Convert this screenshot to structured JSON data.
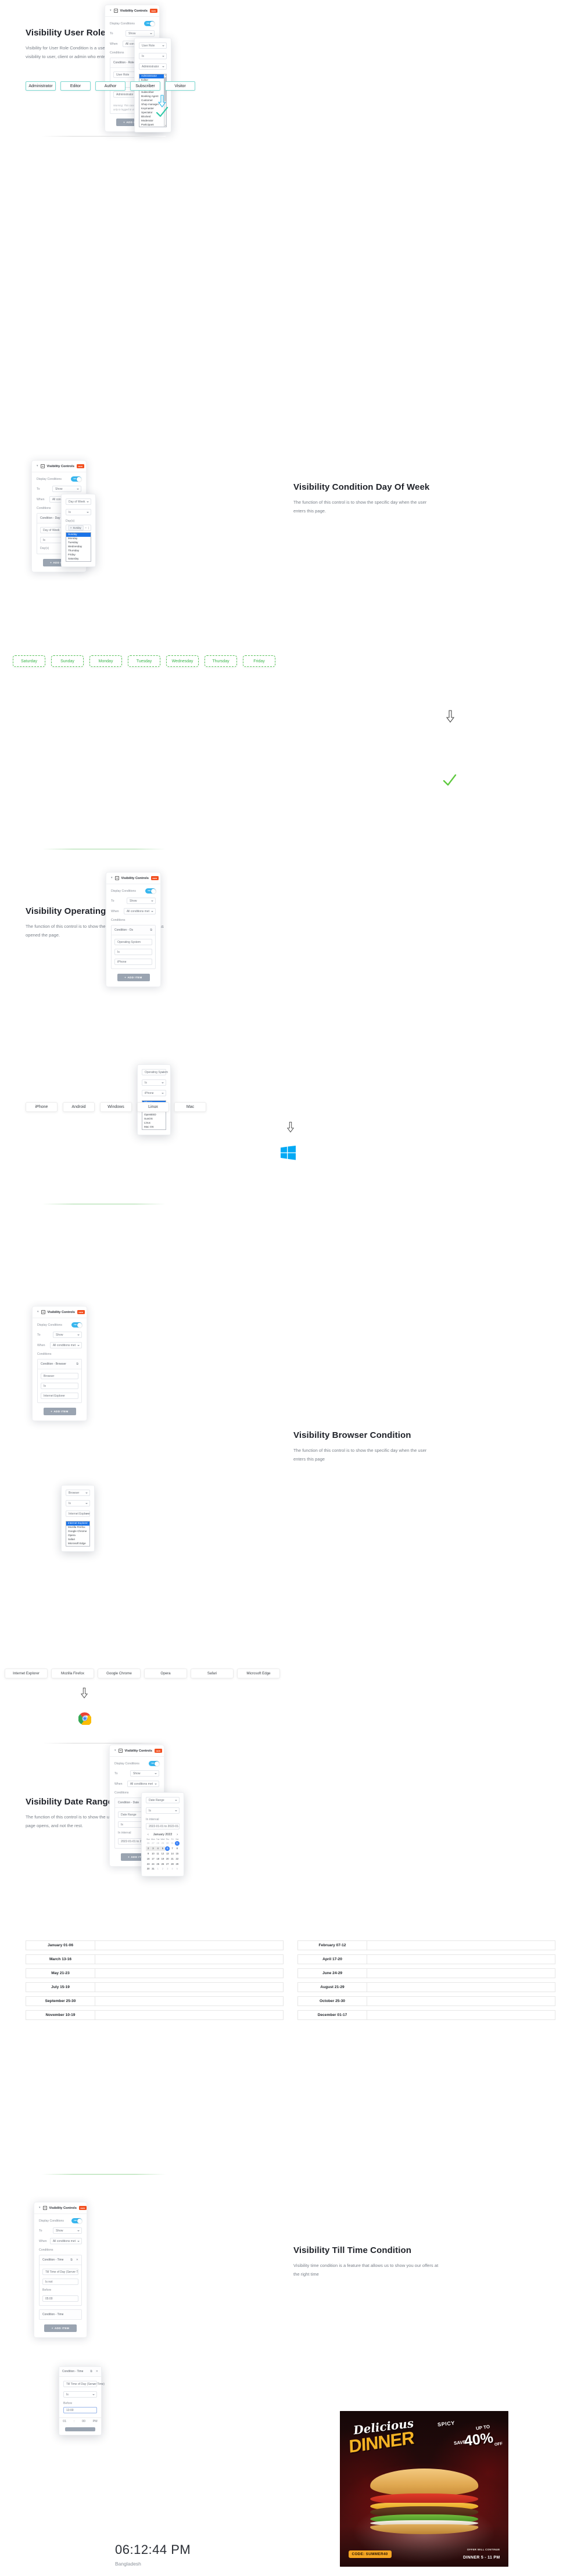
{
  "panel": {
    "title": "Visibility Controls",
    "badge": "NEW",
    "display_conditions_label": "Display Conditions",
    "toggle_state": "YES",
    "to_label": "To",
    "to_value": "Show",
    "when_label": "When",
    "when_value": "All conditions met",
    "conditions_label": "Conditions",
    "add_item_label": "ADD ITEM",
    "add_item_icon": "plus-icon",
    "duplicate_icon": "duplicate-icon",
    "remove_icon": "close-icon",
    "collapse_icon": "chevron-down-icon",
    "page_icon": "page-icon"
  },
  "sections": [
    {
      "id": "user-role",
      "title": "Visibility User Role Condition",
      "body": "Visibility for User Role Condition is a useful add on which provides the visibility to user, client or admin who enters this page.",
      "condition_name": "Condition - Role",
      "field1": "User Role",
      "field2": "Is",
      "field3": "Administrator",
      "warning": "Warning: This condition applies only to logged in visitors.",
      "popup": {
        "select1": "User Role",
        "select2": "Is",
        "select3": "Administrator",
        "options": [
          "Administrator",
          "Editor",
          "Author",
          "Contributor",
          "Subscriber",
          "Booking Agent",
          "Customer",
          "Shop manager",
          "Keymaster",
          "Spectator",
          "Blocked",
          "Moderator",
          "Participant",
          "Shop Accountant",
          "Shop Worker",
          "Shop Vendor",
          "Tutor Instructor",
          "GiveWP Manager",
          "GiveWP Accountant"
        ],
        "selected": "Administrator"
      },
      "pills": [
        "Administrator",
        "Editor",
        "Author",
        "Subscriber",
        "Visitor"
      ],
      "result_icon": "check-icon",
      "arrow_icon": "arrow-down-icon"
    },
    {
      "id": "day-of-week",
      "title": "Visibility Condition Day Of Week",
      "body": "The function of this control is to show the specific day when the user enters this page.",
      "condition_name": "Condition - Day",
      "field1": "Day of Week",
      "field2": "Is",
      "field3_label": "Day(s)",
      "popup": {
        "select1": "Day of Week",
        "select2": "Is",
        "days_label": "Day(s)",
        "chip": "Sunday",
        "chip_remove_icon": "close-icon",
        "chip_add_icon": "plus-icon",
        "options": [
          "Sunday",
          "Monday",
          "Tuesday",
          "Wednesday",
          "Thursday",
          "Friday",
          "Saturday"
        ],
        "selected": "Sunday"
      },
      "pills": [
        "Saturday",
        "Sunday",
        "Monday",
        "Tuesday",
        "Wednesday",
        "Thursday",
        "Friday"
      ],
      "result_icon": "check-icon",
      "arrow_icon": "arrow-down-icon"
    },
    {
      "id": "operating-system",
      "title": "Visibility Operating System",
      "body": "The function of this control is to show the device on which the user has opened the page.",
      "condition_name": "Condition - Os",
      "field1": "Operating System",
      "field2": "Is",
      "field3": "iPhone",
      "popup": {
        "select1": "Operating System",
        "select2": "Is",
        "select3": "iPhone",
        "options": [
          "iPhone",
          "Android",
          "Windows",
          "OpenBSD",
          "SunOS",
          "Linux",
          "Mac OS"
        ],
        "selected": "iPhone"
      },
      "pills": [
        "iPhone",
        "Android",
        "Windows",
        "Linux",
        "Mac"
      ],
      "result_icon": "windows-logo-icon",
      "arrow_icon": "arrow-down-icon"
    },
    {
      "id": "browser",
      "title": "Visibility Browser Condition",
      "body": "The function of this control is to show the specific day when the user enters this page",
      "condition_name": "Condition - Browser",
      "field1": "Browser",
      "field2": "Is",
      "field3": "Internet Explorer",
      "popup": {
        "select1": "Browser",
        "select2": "Is",
        "select3": "Internet Explorer",
        "options": [
          "Internet Explorer",
          "Mozilla Firefox",
          "Google Chrome",
          "Opera",
          "Safari",
          "Microsoft Edge"
        ],
        "selected": "Internet Explorer"
      },
      "pills": [
        "Internet Explorer",
        "Mozilla Firefox",
        "Google Chrome",
        "Opera",
        "Safari",
        "Microsoft Edge"
      ],
      "result_icon": "chrome-logo-icon",
      "arrow_icon": "arrow-down-icon"
    },
    {
      "id": "date-range",
      "title": "Visibility Date Range Condition",
      "body": "The function of this control is to show the user the tasks of the day the page opens, and not the rest.",
      "condition_name": "Condition - Date",
      "field1": "Date Range",
      "field2": "Is",
      "interval_label": "In interval",
      "interval_value": "2022-01-01 to 2022-01-06",
      "popup": {
        "select1": "Date Range",
        "select2": "Is",
        "interval_label": "In interval",
        "interval_value": "2022-01-01 to 2022-01-06"
      },
      "calendar": {
        "month": "January 2022",
        "prev_icon": "chevron-left-icon",
        "next_icon": "chevron-right-icon",
        "dow": [
          "Sun",
          "Mon",
          "Tue",
          "Wed",
          "Thu",
          "Fri",
          "Sat"
        ],
        "weeks": [
          [
            {
              "d": "26",
              "t": "mut"
            },
            {
              "d": "27",
              "t": "mut"
            },
            {
              "d": "28",
              "t": "mut"
            },
            {
              "d": "29",
              "t": "mut"
            },
            {
              "d": "30",
              "t": "mut"
            },
            {
              "d": "31",
              "t": "mut"
            },
            {
              "d": "1",
              "t": "sel-day"
            }
          ],
          [
            {
              "d": "2",
              "t": "inrange"
            },
            {
              "d": "3",
              "t": "inrange"
            },
            {
              "d": "4",
              "t": "inrange"
            },
            {
              "d": "5",
              "t": "inrange"
            },
            {
              "d": "6",
              "t": "sel-day"
            },
            {
              "d": "7",
              "t": ""
            },
            {
              "d": "8",
              "t": ""
            }
          ],
          [
            {
              "d": "9",
              "t": ""
            },
            {
              "d": "10",
              "t": ""
            },
            {
              "d": "11",
              "t": ""
            },
            {
              "d": "12",
              "t": ""
            },
            {
              "d": "13",
              "t": ""
            },
            {
              "d": "14",
              "t": ""
            },
            {
              "d": "15",
              "t": ""
            }
          ],
          [
            {
              "d": "16",
              "t": ""
            },
            {
              "d": "17",
              "t": ""
            },
            {
              "d": "18",
              "t": ""
            },
            {
              "d": "19",
              "t": ""
            },
            {
              "d": "20",
              "t": ""
            },
            {
              "d": "21",
              "t": ""
            },
            {
              "d": "22",
              "t": ""
            }
          ],
          [
            {
              "d": "23",
              "t": ""
            },
            {
              "d": "24",
              "t": ""
            },
            {
              "d": "25",
              "t": ""
            },
            {
              "d": "26",
              "t": ""
            },
            {
              "d": "27",
              "t": ""
            },
            {
              "d": "28",
              "t": ""
            },
            {
              "d": "29",
              "t": ""
            }
          ],
          [
            {
              "d": "30",
              "t": ""
            },
            {
              "d": "31",
              "t": ""
            },
            {
              "d": "1",
              "t": "mut"
            },
            {
              "d": "2",
              "t": "mut"
            },
            {
              "d": "3",
              "t": "mut"
            },
            {
              "d": "4",
              "t": "mut"
            },
            {
              "d": "5",
              "t": "mut"
            }
          ]
        ]
      },
      "date_table": [
        [
          "January 01-06",
          "February 07-12"
        ],
        [
          "March 13-16",
          "April 17-20"
        ],
        [
          "May 21-23",
          "June 24-29"
        ],
        [
          "July 15-19",
          "August 21-29"
        ],
        [
          "September 25-30",
          "October 25-30"
        ],
        [
          "November 10-19",
          "December 01-17"
        ]
      ]
    },
    {
      "id": "till-time",
      "title": "Visibility Till Time Condition",
      "body": "Visibility time condition is a feature that allows us to show you our offers at the right time",
      "condition_name": "Condition - Time",
      "field1": "Till Time of Day (Server Time)",
      "field2": "Is not",
      "before_label": "Before",
      "before_value": "05:00",
      "condition_name2": "Condition - Time",
      "popup": {
        "condition_name": "Condition - Time",
        "select1": "Till Time of Day (Server Time)",
        "select2": "Is",
        "before_label": "Before",
        "before_value": "13:00",
        "time_hour": "01",
        "time_sep": ":",
        "time_min": "00",
        "time_ampm": "PM"
      }
    }
  ],
  "clock": {
    "time": "06:12:44 PM",
    "country": "Bangladesh"
  },
  "banner": {
    "delicious": "Delicious",
    "spicy": "SPICY",
    "dinner": "DINNER",
    "upto": "UP TO",
    "save": "SAVE",
    "percent": "40%",
    "off": "OFF",
    "code": "CODE: SUMMER40",
    "continue": "OFFER WILL CONTINUE",
    "hours": "DINNER 5 - 11 PM"
  },
  "colors": {
    "accent_teal": "#79d8d0",
    "accent_green": "#39b54a",
    "accent_blue": "#37b6ef",
    "badge_red": "#f24e1e",
    "select_blue": "#1a73e8",
    "banner_gold": "#f5b324"
  }
}
